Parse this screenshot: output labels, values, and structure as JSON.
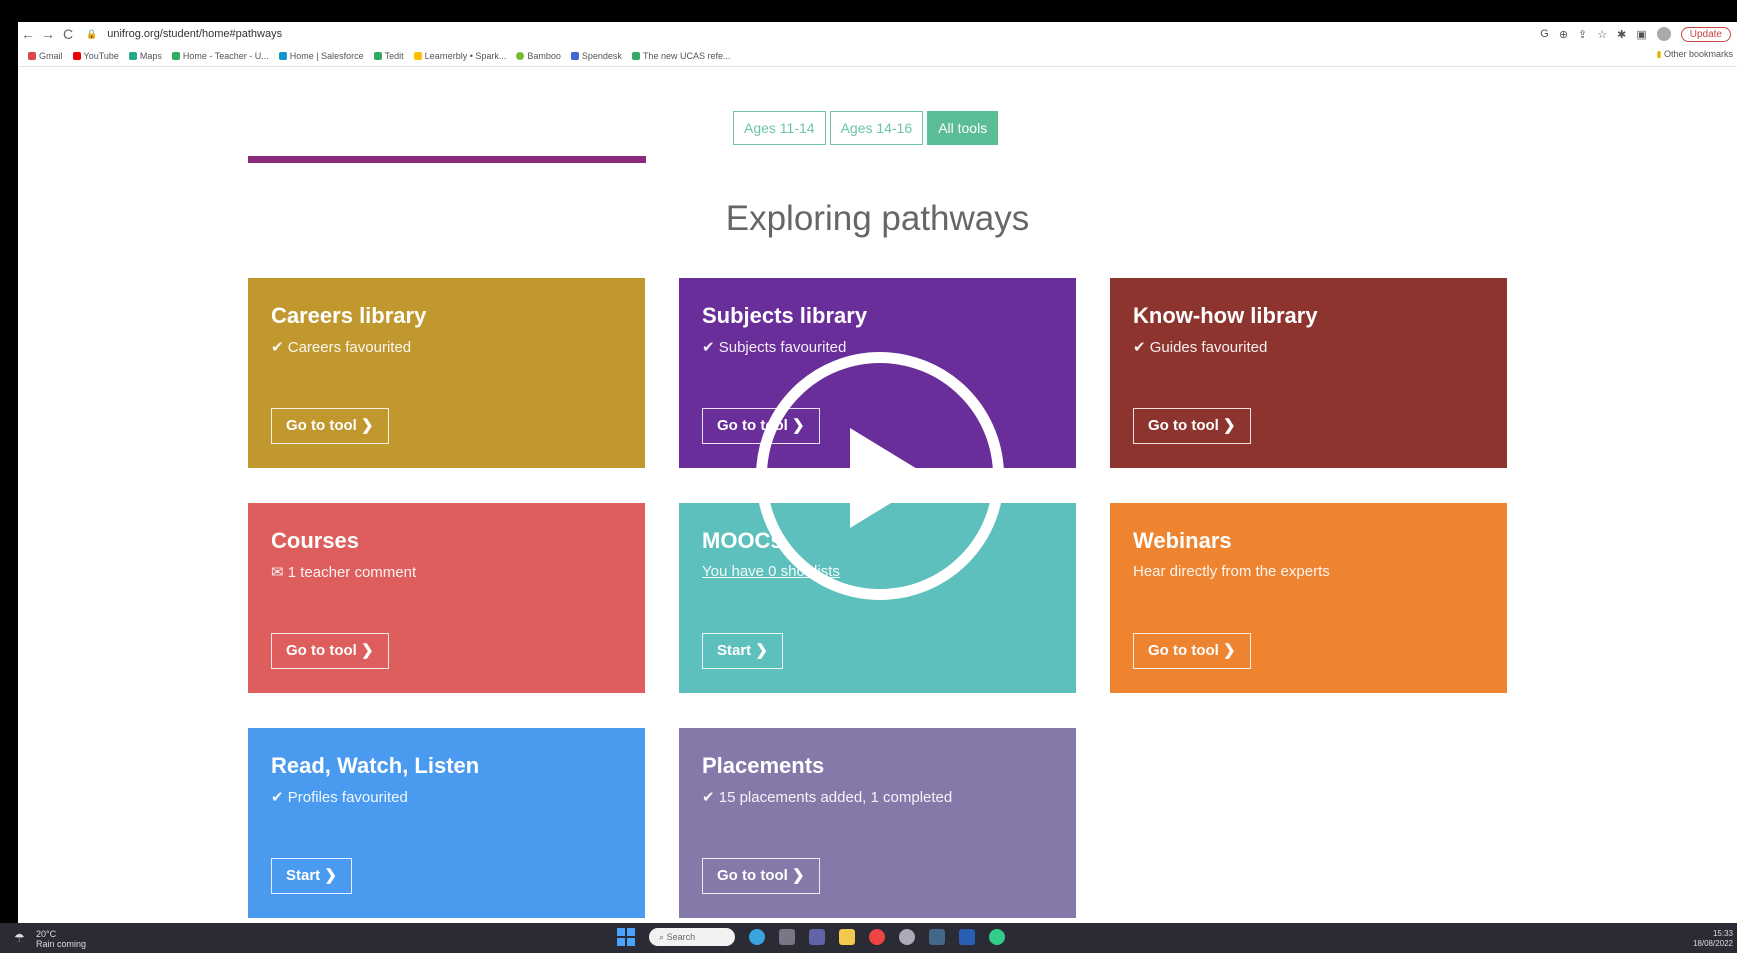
{
  "browser": {
    "url": "unifrog.org/student/home#pathways",
    "update_label": "Update",
    "bookmarks": [
      "Gmail",
      "YouTube",
      "Maps",
      "Home - Teacher - U...",
      "Home | Salesforce",
      "Tedit",
      "Learnerbly • Spark...",
      "Bamboo",
      "Spendesk",
      "The new UCAS refe..."
    ],
    "other_bookmarks": "Other bookmarks"
  },
  "age_tabs": [
    "Ages 11-14",
    "Ages 14-16",
    "All tools"
  ],
  "section_title": "Exploring pathways",
  "cards": [
    {
      "title": "Careers library",
      "sub": "✔ Careers favourited",
      "button": "Go to tool ❯",
      "color": "#c0982e"
    },
    {
      "title": "Subjects library",
      "sub": "✔ Subjects favourited",
      "button": "Go to tool ❯",
      "color": "#6a2e9a"
    },
    {
      "title": "Know-how library",
      "sub": "✔ Guides favourited",
      "button": "Go to tool ❯",
      "color": "#8e342f"
    },
    {
      "title": "Courses",
      "sub": "✉ 1 teacher comment",
      "button": "Go to tool ❯",
      "color": "#dd5e5c"
    },
    {
      "title": "MOOCs",
      "sub": "You have 0 shortlists",
      "button": "Start ❯",
      "color": "#5ec0bd"
    },
    {
      "title": "Webinars",
      "sub": "Hear directly from the experts",
      "button": "Go to tool ❯",
      "color": "#ee8330"
    },
    {
      "title": "Read, Watch, Listen",
      "sub": "✔ Profiles favourited",
      "button": "Start ❯",
      "color": "#4a9bf0"
    },
    {
      "title": "Placements",
      "sub": "✔  15 placements added, 1 completed",
      "button": "Go to tool ❯",
      "color": "#8479a8"
    }
  ],
  "taskbar": {
    "temp": "20°C",
    "weather": "Rain coming",
    "search_placeholder": "Search",
    "time": "15:33",
    "date": "18/08/2022"
  }
}
